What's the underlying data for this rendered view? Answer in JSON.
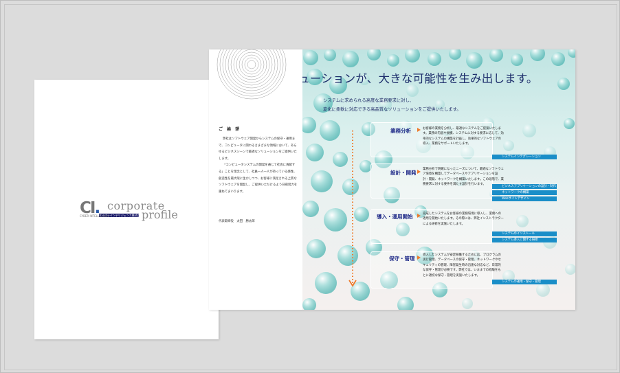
{
  "cover": {
    "logo_mark": "CI",
    "logo_line1": "corporate",
    "logo_line2": "profile",
    "logo_bar": "サイバーインテリジェンス株式会社",
    "logo_small": "CYBER INTELLIGENCE"
  },
  "greeting": {
    "title": "ご 挨 拶",
    "paragraphs": [
      "弊社はソフトウェア開発からシステムの保守・運用まで、コンピュータに関わるさまざまな領域において、あらゆるビジネスシーンで最適なソリューションをご提供いたします。",
      "「コンピュータシステムの開発を通じて社会に貢献する」ことを理念として、社員一人一人が持っている感性、創造性を最大限に生かしつつ、お客様に満足される上質なソフトウェアを開発し、ご提供いただけるよう日夜努力を重ねてまいります。"
    ],
    "signature": "代表取締役　太田　勝太郎"
  },
  "headline": "高品質なソリューションが、大きな可能性を生み出します。",
  "subline": [
    "システムに求められる高度な業務要求に対し、",
    "変化に柔軟に対応できる高品質なソリューションをご提供いたします。"
  ],
  "services": [
    {
      "title": "業務分析",
      "text": "お客様の業務を分析し、最適なシステムをご提案いたします。業務の内容や規模、システムに対する要求に応じて、効率的なシステムの構築を計画し、効果的なソフトウェアの導入、業務をサポートいたします。",
      "tags": [
        "システムインテグレーション"
      ]
    },
    {
      "title": "設計・開発",
      "text": "業務分析で明確になったニーズについて、最適なソフトウェア環境を構築してデータベースやアプリケーションを設計・開発、ネットワークを構築いたします。この段階で、業務要求に対する要件を満たす設計を行います。",
      "tags": [
        "ビジネスアプリケーションの設計・制作",
        "ネットワークの構築",
        "Webサイトデザイン"
      ]
    },
    {
      "title": "導入・運用開始",
      "text": "完成したシステムをお客様の業務環境に導入し、業務への適用を開始いたします。その際には、弊社インストラクターによる研修を実施いたします。",
      "tags": [
        "システムのインストール",
        "システム導入に関する研修"
      ]
    },
    {
      "title": "保守・管理",
      "text": "導入したシステムが安定稼働するためには、プログラムの実行管理、データベースの保守・管理、ネットワークやセキュリティの管理、障害発生時の迅速な対応など、日常的な保守・管理が必要です。弊社では、いままでの経験をもとに適切な保守・管理を実施いたします。",
      "tags": [
        "システムの運用・保守・管理"
      ]
    }
  ],
  "colors": {
    "navy": "#1c2d6b",
    "title_blue": "#1f2a88",
    "accent_orange": "#ef7a2a",
    "tag_blue": "#1a8ec8"
  }
}
